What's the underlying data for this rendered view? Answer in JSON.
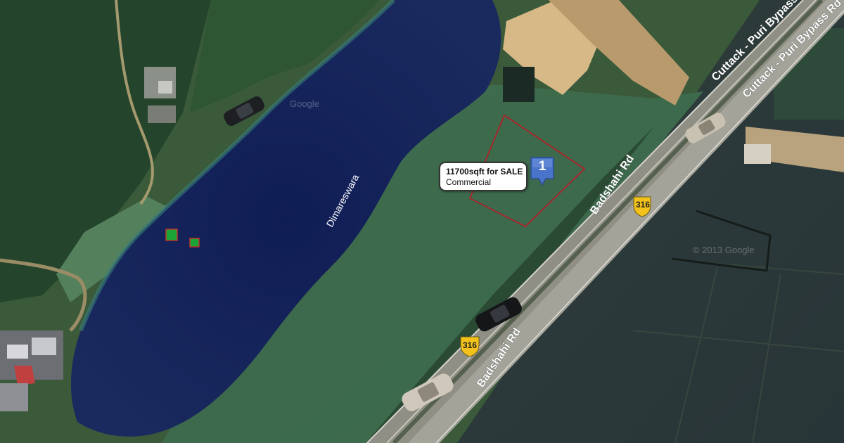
{
  "map": {
    "lake_label": "Dimareswara",
    "watermark_1": "Google",
    "watermark_2": "© 2013 Google",
    "roads": {
      "upper_label_1": "Cuttack - Puri Bypass",
      "upper_label_2": "Cuttack - Puri Bypass Rd",
      "lower_label_1": "Badshahi Rd",
      "lower_label_2": "Badshahi Rd",
      "shield_1": "316",
      "shield_2": "316"
    },
    "plot_outline_color": "#b0202a",
    "shield_color": "#f2c21b",
    "marker_color": "#4a74c9"
  },
  "listing": {
    "title": "11700sqft for SALE",
    "type": "Commercial",
    "marker_number": "1"
  }
}
